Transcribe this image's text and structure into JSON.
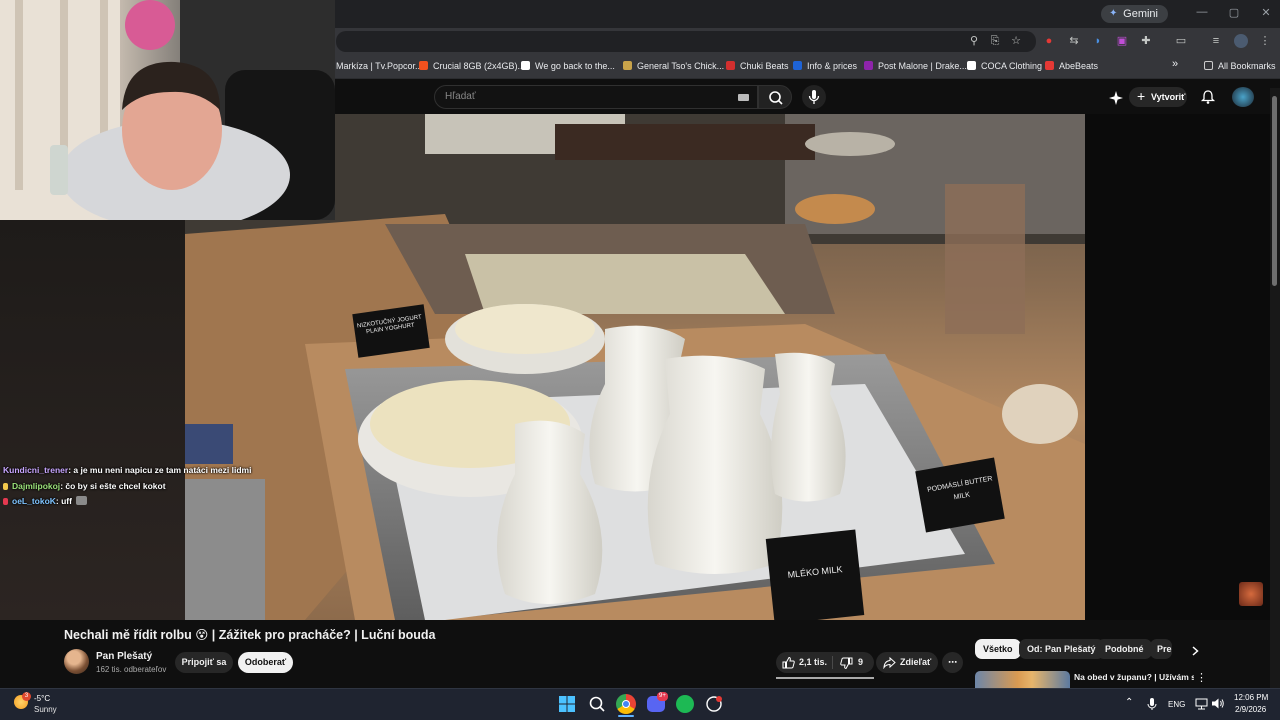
{
  "browser": {
    "gemini_label": "Gemini",
    "bookmarks": [
      {
        "label": "Markíza | Tv.Popcor...",
        "color": "#e53935"
      },
      {
        "label": "Crucial 8GB (2x4GB)...",
        "color": "#f4511e"
      },
      {
        "label": "We go back to the...",
        "color": "#ffffff"
      },
      {
        "label": "General Tso's Chick...",
        "color": "#c9a34a"
      },
      {
        "label": "Chuki Beats",
        "color": "#d32f2f"
      },
      {
        "label": "Info & prices",
        "color": "#1e63d6"
      },
      {
        "label": "Post Malone | Drake...",
        "color": "#8e24aa"
      },
      {
        "label": "COCA Clothing",
        "color": "#ffffff"
      },
      {
        "label": "AbeBeats",
        "color": "#e53935"
      }
    ],
    "all_bookmarks": "All Bookmarks",
    "bookmarks_overflow": "»"
  },
  "youtube": {
    "search_placeholder": "Hľadať",
    "create_label": "Vytvoriť",
    "video": {
      "title": "Nechali mě řídit rolbu 😵 | Zážitek pro pracháče? | Luční bouda",
      "channel": "Pan Plešatý",
      "subscribers": "162 tis. odberateľov",
      "join": "Pripojiť sa",
      "subscribe": "Odoberať",
      "likes": "2,1 tis.",
      "dislikes": "9",
      "share": "Zdieľať",
      "more": "⋯",
      "signs": {
        "sign_left": "NIZKOTUČNÝ JOGURT PLAIN YOGHURT",
        "sign_right": "PODMÁSLÍ BUTTER MILK",
        "sign_bottom": "MLÉKO MILK"
      }
    },
    "chips": [
      "Všetko",
      "Od: Pan Plešatý",
      "Podobné",
      "Pre"
    ],
    "recommendation_title": "Na obed v županu? | Užívám si"
  },
  "stream_chat": [
    {
      "user": "Kundicni_trener",
      "message": ": a je mu neni napicu ze tam natáci mezi lidmi",
      "badge": "#c8a6ff",
      "color": "#c8a6ff"
    },
    {
      "user": "Dajmlipokoj",
      "message": ": čo by si ešte chcel kokot",
      "badge": "#f2c94c",
      "color": "#9be37a"
    },
    {
      "user": "oeL_tokoK",
      "message": ": uff",
      "badge": "#e53950",
      "color": "#7fc4ff"
    }
  ],
  "taskbar": {
    "temperature": "-5°C",
    "weather": "Sunny",
    "weather_badge": "3",
    "language": "ENG",
    "time": "12:06 PM",
    "date": "2/9/2026",
    "discord_badge": "9+"
  }
}
